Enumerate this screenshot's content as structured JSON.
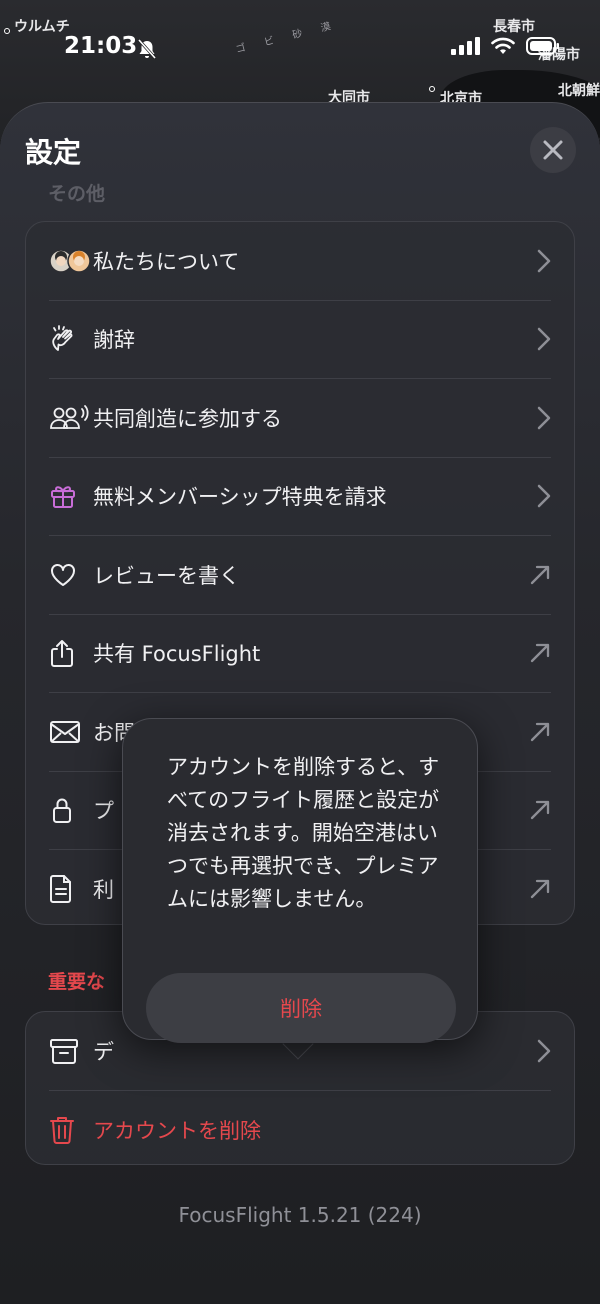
{
  "status_bar": {
    "time": "21:03"
  },
  "map": {
    "labels": [
      "ウルムチ",
      "長春市",
      "瀋陽市",
      "大同市",
      "北京市",
      "北朝鮮",
      "ゴ ビ 砂 漠"
    ]
  },
  "sheet": {
    "title": "設定",
    "section_other": "その他",
    "items": [
      {
        "label": "私たちについて",
        "icon": "avatars-icon"
      },
      {
        "label": "謝辞",
        "icon": "clapping-hands-icon"
      },
      {
        "label": "共同創造に参加する",
        "icon": "people-icon"
      },
      {
        "label": "無料メンバーシップ特典を請求",
        "icon": "gift-icon"
      },
      {
        "label": "レビューを書く",
        "icon": "heart-icon"
      },
      {
        "label": "共有 FocusFlight",
        "icon": "share-icon"
      },
      {
        "label": "お問",
        "icon": "mail-icon"
      },
      {
        "label": "プ",
        "icon": "lock-icon"
      },
      {
        "label": "利",
        "icon": "document-icon"
      }
    ],
    "section_danger": "重要な",
    "danger_items": [
      {
        "label": "デ",
        "icon": "archive-icon"
      },
      {
        "label": "アカウントを削除",
        "icon": "trash-icon"
      }
    ],
    "version": "FocusFlight 1.5.21 (224)"
  },
  "popover": {
    "message": "アカウントを削除すると、すべてのフライト履歴と設定が消去されます。開始空港はいつでも再選択でき、プレミアムには影響しません。",
    "delete_label": "削除"
  },
  "colors": {
    "danger": "#e5484d",
    "accent_gift": "#c86dd7"
  }
}
